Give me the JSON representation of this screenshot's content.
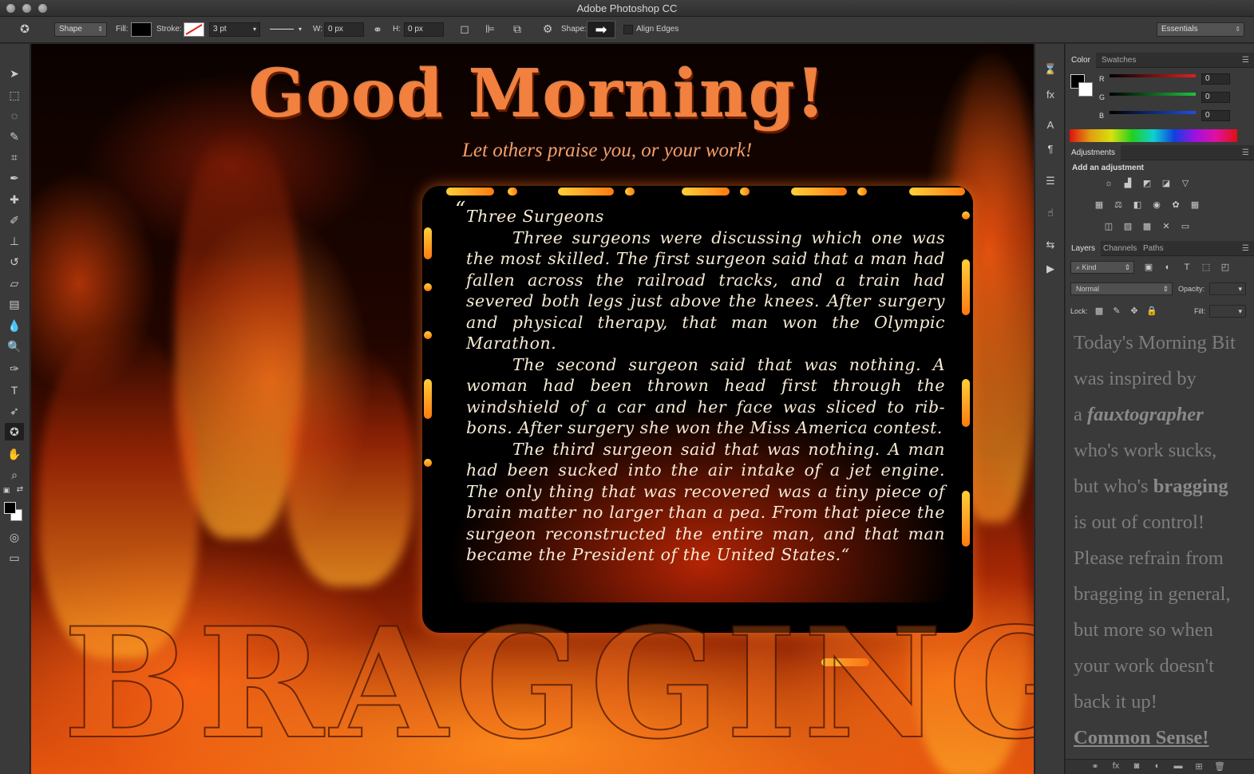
{
  "window": {
    "title": "Adobe Photoshop CC"
  },
  "options_bar": {
    "tool_mode": "Shape",
    "fill_label": "Fill:",
    "stroke_label": "Stroke:",
    "stroke_width": "3 pt",
    "w_label": "W:",
    "w_value": "0 px",
    "h_label": "H:",
    "h_value": "0 px",
    "shape_label": "Shape:",
    "align_edges_label": "Align Edges",
    "workspace": "Essentials"
  },
  "canvas": {
    "headline": "Good Morning!",
    "subheadline": "Let others praise you, or your work!",
    "story_title": "Three Surgeons",
    "story_p1": "Three surgeons were discussing which one was the most skilled. The first surgeon said that a man had fallen across the railroad tracks, and a train had severed both legs just above the knees. After surgery and physical therapy, that man won the Olympic Marathon.",
    "story_p2": "The second surgeon said that was nothing. A woman had been thrown head first through the windshield of a car and her face was sliced to rib-bons. After surgery she won the Miss America contest.",
    "story_p3": "The third surgeon said that was nothing. A man had been sucked into the air intake of a jet engine. The only thing that was recovered was a tiny piece of brain matter no larger than a pea. From that piece the surgeon reconstructed the entire man, and that man became the President of the United States.",
    "open_quote": "“",
    "close_quote": "“",
    "bottom_word": "BRAGGING"
  },
  "color_panel": {
    "tabs": [
      "Color",
      "Swatches"
    ],
    "channels": [
      {
        "label": "R",
        "value": "0",
        "color": "#e02020"
      },
      {
        "label": "G",
        "value": "0",
        "color": "#20c040"
      },
      {
        "label": "B",
        "value": "0",
        "color": "#2050e0"
      }
    ]
  },
  "adjustments_panel": {
    "tab": "Adjustments",
    "heading": "Add an adjustment"
  },
  "layers_panel": {
    "tabs": [
      "Layers",
      "Channels",
      "Paths"
    ],
    "filter_kind": "Kind",
    "blend_mode": "Normal",
    "opacity_label": "Opacity:",
    "lock_label": "Lock:",
    "fill_label": "Fill:",
    "overlay_text": {
      "l1": "Today's Morning Bit",
      "l2": "was inspired by",
      "l3_pre": "a ",
      "l3_em": "fauxtographer",
      "l4": "who's work sucks,",
      "l5_pre": "but who's ",
      "l5_b": "bragging",
      "l6": "is out of control!",
      "l7": "Please refrain from",
      "l8": "bragging in general,",
      "l9": "but more so when",
      "l10": "your work doesn't",
      "l11": "back it up!",
      "l12": "Common Sense!"
    }
  }
}
